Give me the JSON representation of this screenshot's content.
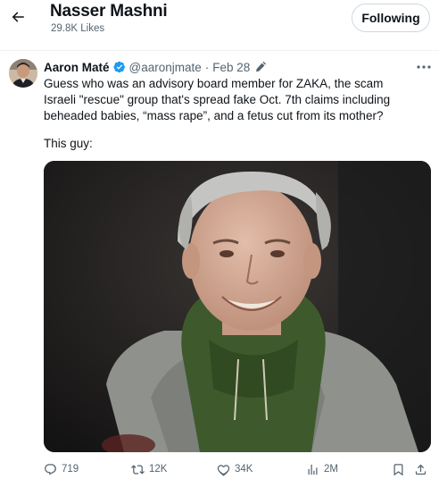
{
  "header": {
    "title": "Nasser Mashni",
    "subtitle": "29.8K Likes",
    "follow_label": "Following",
    "back_icon": "arrow-left-icon"
  },
  "tweet": {
    "author_name": "Aaron Maté",
    "handle": "@aaronjmate",
    "separator": "·",
    "date": "Feb 28",
    "verified_color": "#1d9bf0",
    "text": "Guess who was an advisory board member for ZAKA, the scam Israeli \"rescue\" group that's spread fake Oct. 7th claims including beheaded babies, “mass rape”, and a fetus cut from its mother?",
    "text2": "This guy:",
    "actions": {
      "replies": "719",
      "reposts": "12K",
      "likes": "34K",
      "views": "2M"
    }
  },
  "colors": {
    "text_primary": "#0f1419",
    "text_secondary": "#536471",
    "border": "#cfd9de",
    "verified": "#1d9bf0"
  }
}
